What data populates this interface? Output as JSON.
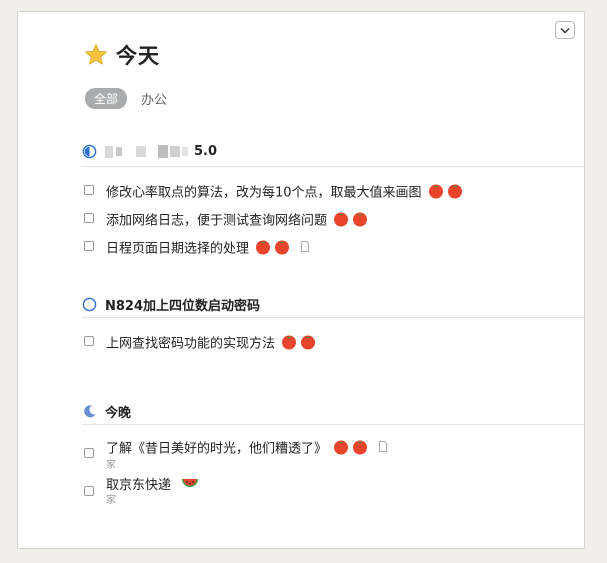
{
  "header": {
    "title": "今天",
    "icon": "star-icon",
    "star_color": "#f5c242"
  },
  "filters": {
    "all_label": "全部",
    "office_label": "办公"
  },
  "sections": [
    {
      "name": "5.0",
      "icon": "progress-circle-icon",
      "tasks": [
        {
          "text": "修改心率取点的算法，改为每10个点，取最大值来画图",
          "tomatoes": 2,
          "note": false
        },
        {
          "text": "添加网络日志，便于测试查询网络问题",
          "tomatoes": 2,
          "note": false
        },
        {
          "text": "日程页面日期选择的处理",
          "tomatoes": 2,
          "note": true
        }
      ]
    },
    {
      "name": "N824加上四位数启动密码",
      "icon": "circle-icon",
      "tasks": [
        {
          "text": "上网查找密码功能的实现方法",
          "tomatoes": 2,
          "note": false
        }
      ]
    },
    {
      "name": "今晚",
      "icon": "moon-icon",
      "tasks": [
        {
          "text": "了解《昔日美好的时光，他们糟透了》",
          "tomatoes": 2,
          "note": true,
          "sub": "家"
        },
        {
          "text": "取京东快递",
          "watermelon": true,
          "sub": "家"
        }
      ]
    }
  ],
  "colors": {
    "accent": "#2a6fd6",
    "tomato": "#e8452c",
    "moon": "#6b8fd4"
  }
}
